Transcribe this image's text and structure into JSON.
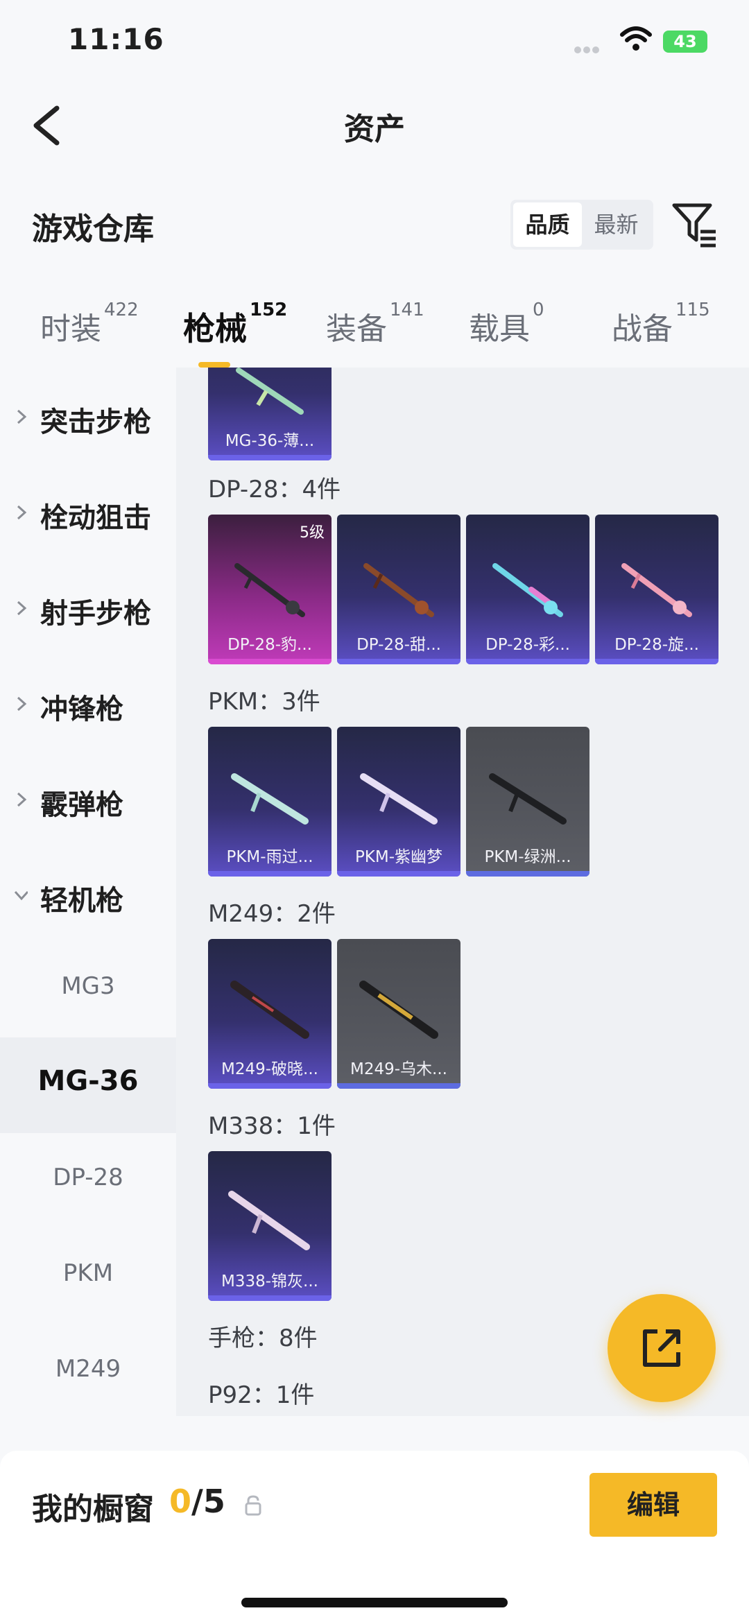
{
  "status": {
    "time": "11:16",
    "battery": "43"
  },
  "nav": {
    "title": "资产"
  },
  "warehouse": {
    "label": "游戏仓库",
    "sort_options": [
      "品质",
      "最新"
    ]
  },
  "tabs": [
    {
      "label": "时装",
      "count": "422"
    },
    {
      "label": "枪械",
      "count": "152"
    },
    {
      "label": "装备",
      "count": "141"
    },
    {
      "label": "载具",
      "count": "0"
    },
    {
      "label": "战备",
      "count": "115"
    }
  ],
  "sidebar": {
    "categories": [
      "突击步枪",
      "栓动狙击",
      "射手步枪",
      "冲锋枪",
      "霰弹枪",
      "轻机枪"
    ],
    "subitems": [
      "MG3",
      "MG-36",
      "DP-28",
      "PKM",
      "M249"
    ],
    "active_sub": "MG-36"
  },
  "groups": [
    {
      "title": "DP-28：4件",
      "items": [
        {
          "name": "DP-28-豹...",
          "level": "5级",
          "style": "gold"
        },
        {
          "name": "DP-28-甜...",
          "style": "purple"
        },
        {
          "name": "DP-28-彩...",
          "style": "purple"
        },
        {
          "name": "DP-28-旋...",
          "style": "purple"
        }
      ]
    },
    {
      "title": "PKM：3件",
      "items": [
        {
          "name": "PKM-雨过...",
          "style": "purple"
        },
        {
          "name": "PKM-紫幽梦",
          "style": "purple"
        },
        {
          "name": "PKM-绿洲...",
          "style": "grey"
        }
      ]
    },
    {
      "title": "M249：2件",
      "items": [
        {
          "name": "M249-破晓...",
          "style": "purple"
        },
        {
          "name": "M249-乌木...",
          "style": "grey"
        }
      ]
    },
    {
      "title": "M338：1件",
      "items": [
        {
          "name": "M338-锦灰...",
          "style": "purple"
        }
      ]
    },
    {
      "title": "手枪：8件",
      "items": []
    },
    {
      "title": "P92：1件",
      "items": []
    }
  ],
  "top_card": {
    "name": "MG-36-薄..."
  },
  "bottom": {
    "label": "我的橱窗",
    "current": "0",
    "total": "/5",
    "edit_label": "编辑"
  },
  "colors": {
    "accent": "#f5b927",
    "purple_card": "#34306d",
    "gold_card": "#8a2a86",
    "grey_card": "#54565d"
  }
}
